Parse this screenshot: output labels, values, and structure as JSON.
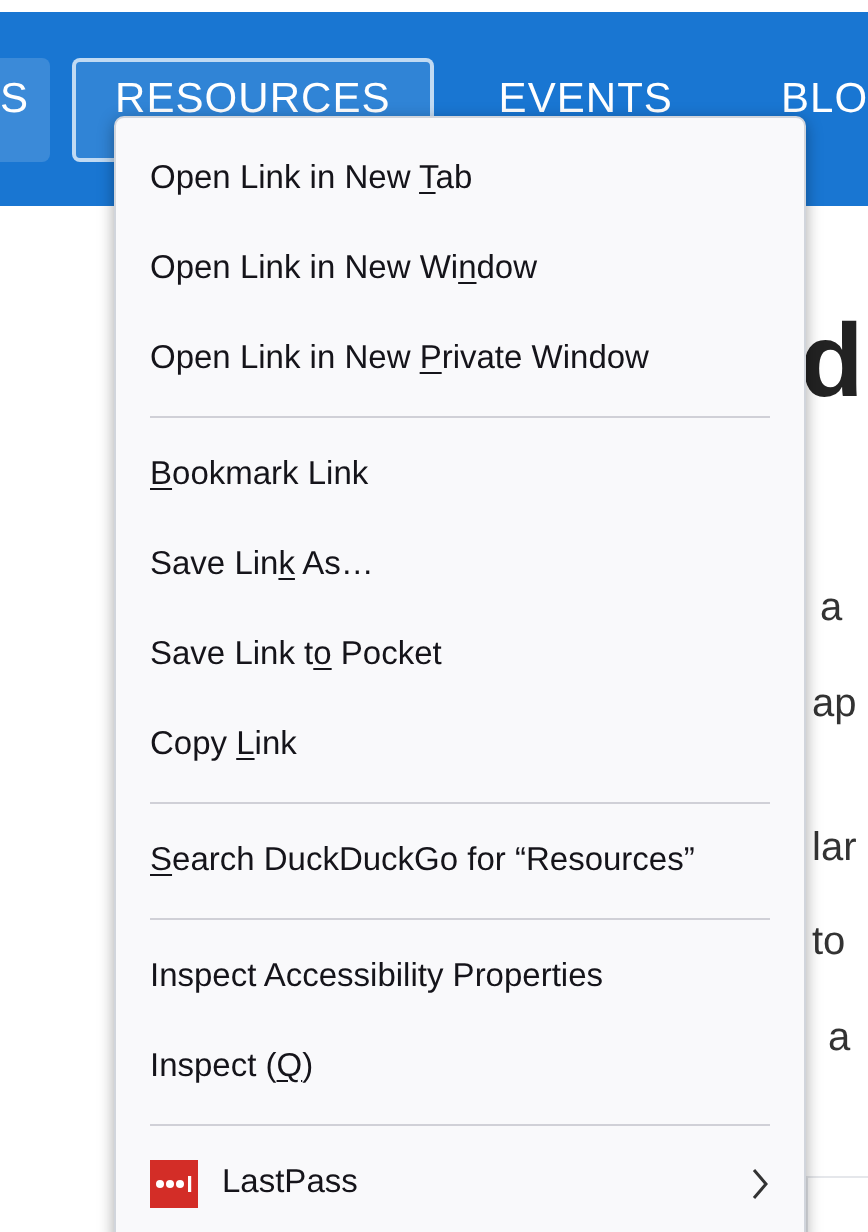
{
  "nav": {
    "items": [
      {
        "label": "S",
        "selected": false,
        "hovered": true
      },
      {
        "label": "RESOURCES",
        "selected": true,
        "hovered": false
      },
      {
        "label": "EVENTS",
        "selected": false,
        "hovered": false
      },
      {
        "label": "BLO",
        "selected": false,
        "hovered": false
      }
    ]
  },
  "page": {
    "heading": "d",
    "lines": [
      "a",
      "ap",
      "lar",
      "to",
      "a"
    ]
  },
  "context_menu": {
    "items": [
      {
        "kind": "item",
        "before": "Open Link in New ",
        "key": "T",
        "after": "ab"
      },
      {
        "kind": "item",
        "before": "Open Link in New Wi",
        "key": "n",
        "after": "dow"
      },
      {
        "kind": "item",
        "before": "Open Link in New ",
        "key": "P",
        "after": "rivate Window"
      },
      {
        "kind": "separator"
      },
      {
        "kind": "item",
        "key": "B",
        "after": "ookmark Link"
      },
      {
        "kind": "item",
        "before": "Save Lin",
        "key": "k",
        "after": " As…"
      },
      {
        "kind": "item",
        "before": "Save Link t",
        "key": "o",
        "after": " Pocket"
      },
      {
        "kind": "item",
        "before": "Copy ",
        "key": "L",
        "after": "ink"
      },
      {
        "kind": "separator"
      },
      {
        "kind": "item",
        "key": "S",
        "after": "earch DuckDuckGo for “Resources”"
      },
      {
        "kind": "separator"
      },
      {
        "kind": "item",
        "before": "Inspect Accessibility Properties"
      },
      {
        "kind": "item",
        "before": "Inspect (",
        "key": "Q",
        "after": ")"
      },
      {
        "kind": "separator"
      },
      {
        "kind": "submenu",
        "before": "LastPass"
      }
    ]
  }
}
